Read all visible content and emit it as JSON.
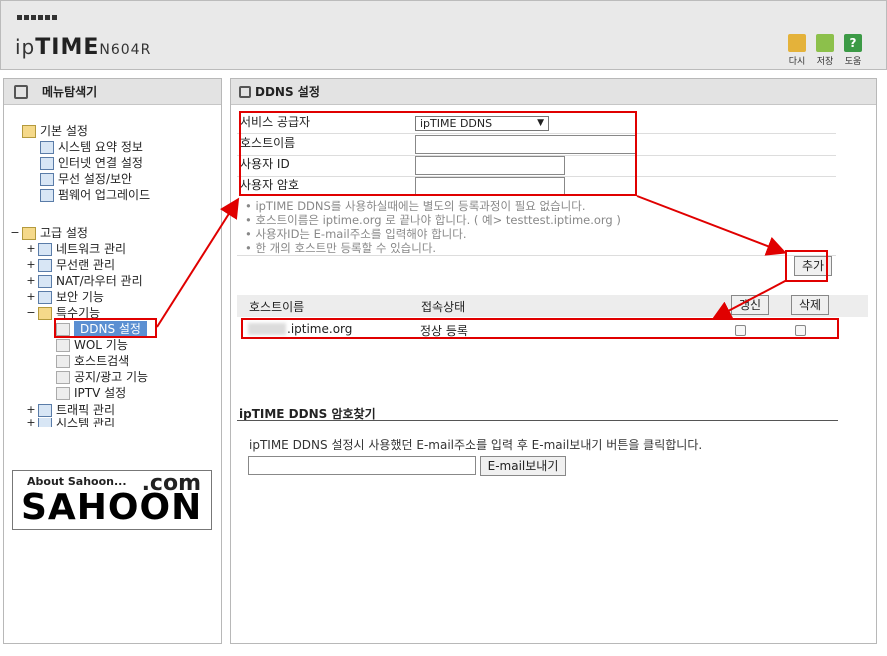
{
  "header": {
    "brand_ip": "ip",
    "brand_time": "TIME",
    "brand_model": "N604R",
    "buttons": [
      {
        "label": "다시",
        "icon": "refresh-icon"
      },
      {
        "label": "저장",
        "icon": "save-icon"
      },
      {
        "label": "도움",
        "icon": "help-icon"
      }
    ],
    "help_glyph": "?"
  },
  "left": {
    "title": "메뉴탐색기",
    "tree": [
      {
        "label": "기본 설정"
      },
      {
        "label": "시스템 요약 정보"
      },
      {
        "label": "인터넷 연결 설정"
      },
      {
        "label": "무선 설정/보안"
      },
      {
        "label": "펌웨어 업그레이드"
      },
      {
        "label": "고급 설정"
      },
      {
        "label": "네트워크 관리"
      },
      {
        "label": "무선랜 관리"
      },
      {
        "label": "NAT/라우터 관리"
      },
      {
        "label": "보안 기능"
      },
      {
        "label": "특수기능"
      },
      {
        "label": "DDNS 설정"
      },
      {
        "label": "WOL 기능"
      },
      {
        "label": "호스트검색"
      },
      {
        "label": "공지/광고 기능"
      },
      {
        "label": "IPTV 설정"
      },
      {
        "label": "트래픽 관리"
      },
      {
        "label": "시스템 관리"
      }
    ],
    "ad": {
      "about": "About Sahoon...",
      "com": ".com",
      "name": "SAHOON"
    }
  },
  "main": {
    "title": "DDNS 설정",
    "form": {
      "provider_label": "서비스 공급자",
      "provider_value": "ipTIME DDNS",
      "host_label": "호스트이름",
      "host_value": "",
      "user_label": "사용자 ID",
      "user_value": "",
      "pw_label": "사용자 암호",
      "pw_value": ""
    },
    "notes": [
      "• ipTIME DDNS를 사용하실때에는 별도의 등록과정이 필요 없습니다.",
      "• 호스트이름은 iptime.org 로 끝나야 합니다. ( 예> testtest.iptime.org )",
      "• 사용자ID는 E-mail주소를 입력해야 합니다.",
      "• 한 개의 호스트만 등록할 수 있습니다."
    ],
    "add_button": "추가",
    "table": {
      "headers": [
        "호스트이름",
        "접속상태",
        "갱신",
        "삭제"
      ],
      "rows": [
        {
          "host": ".iptime.org",
          "status": "정상 등록"
        }
      ]
    },
    "find_pw": {
      "title": "ipTIME DDNS 암호찾기",
      "description": "ipTIME DDNS 설정시 사용했던 E-mail주소를 입력 후 E-mail보내기 버튼을 클릭합니다.",
      "email_value": "",
      "send_button": "E-mail보내기"
    }
  }
}
